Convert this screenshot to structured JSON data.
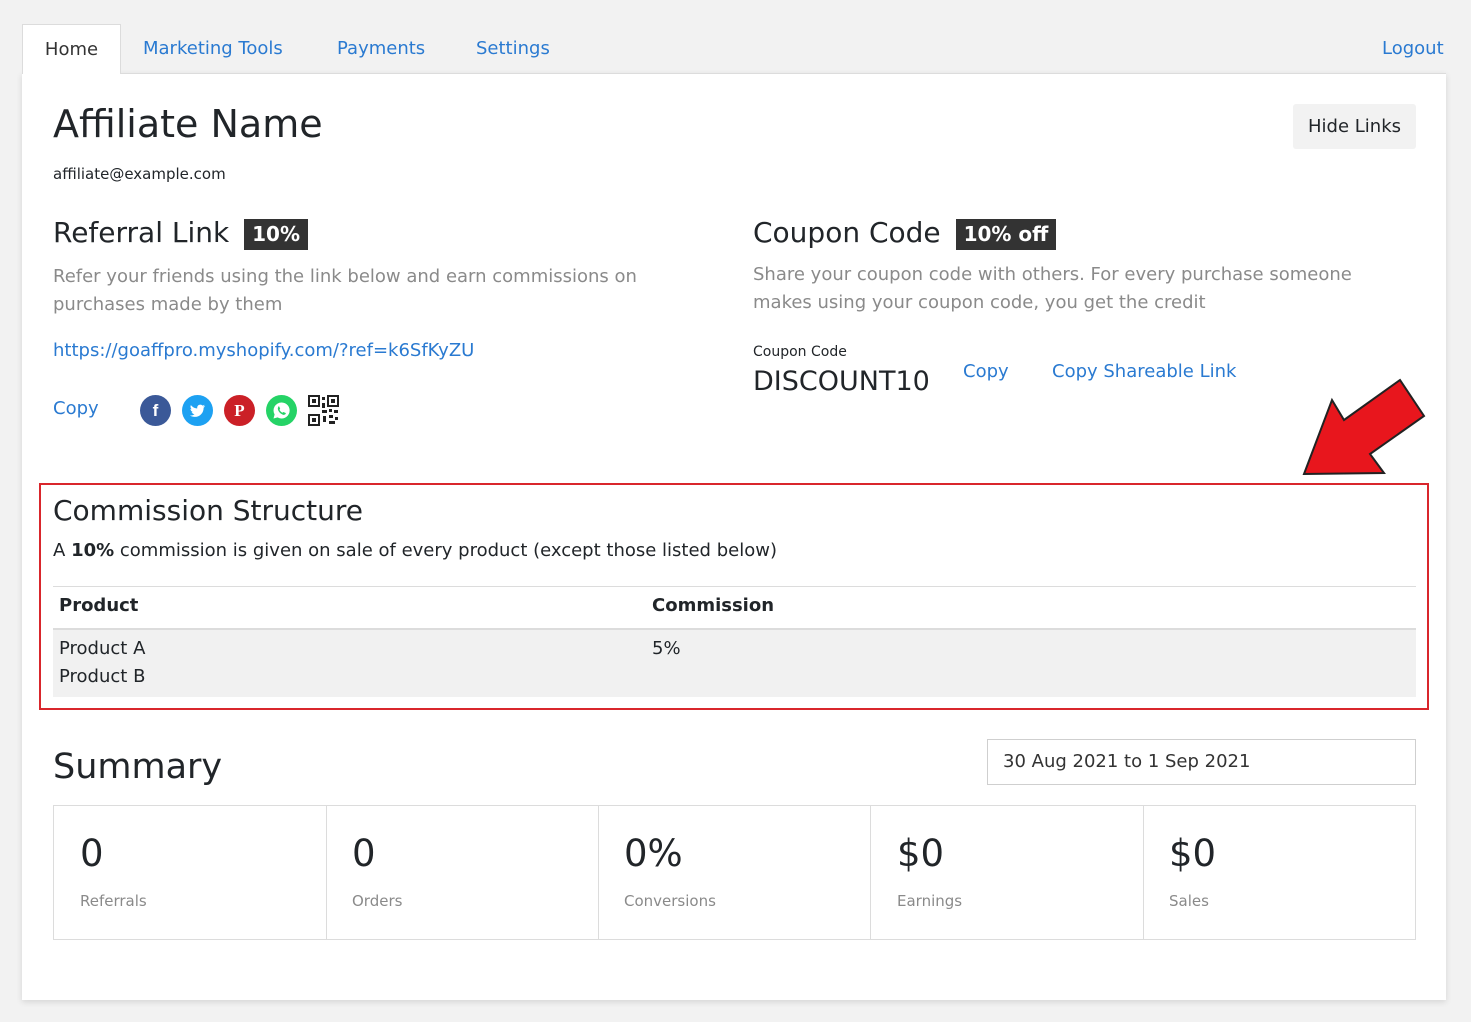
{
  "nav": {
    "tabs": [
      "Home",
      "Marketing Tools",
      "Payments",
      "Settings"
    ],
    "logout": "Logout"
  },
  "profile": {
    "name": "Affiliate Name",
    "email": "affiliate@example.com",
    "hide_links": "Hide Links"
  },
  "referral": {
    "title": "Referral Link",
    "badge": "10%",
    "description": "Refer your friends using the link below and earn commissions on purchases made by them",
    "url": "https://goaffpro.myshopify.com/?ref=k6SfKyZU",
    "copy": "Copy",
    "share_icons": [
      "facebook-icon",
      "twitter-icon",
      "pinterest-icon",
      "whatsapp-icon",
      "qr-code-icon"
    ]
  },
  "coupon": {
    "title": "Coupon Code",
    "badge": "10% off",
    "description": "Share your coupon code with others. For every purchase someone makes using your coupon code, you get the credit",
    "label": "Coupon Code",
    "code": "DISCOUNT10",
    "copy": "Copy",
    "copy_shareable": "Copy Shareable Link"
  },
  "commission": {
    "title": "Commission Structure",
    "text_prefix": "A",
    "rate": "10%",
    "text_suffix": "commission is given on sale of every product (except those listed below)",
    "columns": [
      "Product",
      "Commission"
    ],
    "rows": [
      {
        "products": [
          "Product A",
          "Product B"
        ],
        "commission": "5%"
      }
    ]
  },
  "summary": {
    "title": "Summary",
    "date_range": "30 Aug 2021 to 1 Sep 2021",
    "stats": [
      {
        "value": "0",
        "label": "Referrals"
      },
      {
        "value": "0",
        "label": "Orders"
      },
      {
        "value": "0%",
        "label": "Conversions"
      },
      {
        "value": "$0",
        "label": "Earnings"
      },
      {
        "value": "$0",
        "label": "Sales"
      }
    ]
  },
  "colors": {
    "link": "#2a7ad1",
    "highlight_border": "#d9262c",
    "arrow": "#e8161d",
    "facebook": "#3b5998",
    "twitter": "#1da1f2",
    "pinterest": "#cb2027",
    "whatsapp": "#25d366"
  }
}
